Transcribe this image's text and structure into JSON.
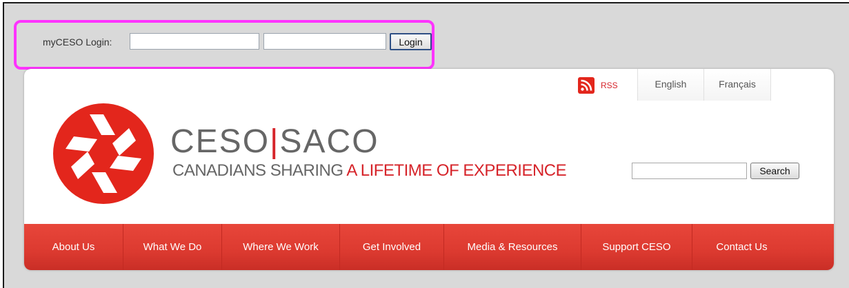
{
  "login": {
    "label": "myCESO Login:",
    "username_value": "",
    "password_value": "",
    "button_label": "Login"
  },
  "header": {
    "rss_label": "RSS",
    "languages": [
      "English",
      "Français"
    ],
    "brand_left": "CESO",
    "brand_sep": "|",
    "brand_right": "SACO",
    "tagline_gray": "CANADIANS SHARING ",
    "tagline_red": "A LIFETIME OF EXPERIENCE"
  },
  "search": {
    "value": "",
    "button_label": "Search"
  },
  "nav": {
    "items": [
      "About Us",
      "What We Do",
      "Where We Work",
      "Get Involved",
      "Media & Resources",
      "Support CESO",
      "Contact Us"
    ]
  },
  "colors": {
    "brand_red": "#d6242a",
    "highlight_magenta": "#ff33ff",
    "nav_red": "#dc3a30"
  },
  "icons": {
    "rss": "rss-icon",
    "logo": "ceso-logo"
  }
}
